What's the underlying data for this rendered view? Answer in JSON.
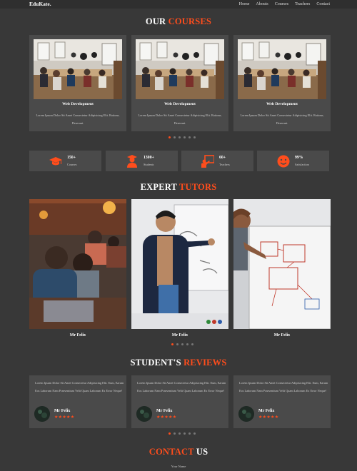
{
  "nav": {
    "logo": "EduKate.",
    "items": [
      "Home",
      "Abouts",
      "Courses",
      "Teachers",
      "Contact"
    ]
  },
  "courses": {
    "title_main": "OUR",
    "title_accent": "COURSES",
    "cards": [
      {
        "title": "Web Development",
        "desc": "Lorem Ipsum Dolor Sit Amet Consectetur Adipisicing Elit. Ratione, Deserunt."
      },
      {
        "title": "Web Development",
        "desc": "Lorem Ipsum Dolor Sit Amet Consectetur Adipisicing Elit. Ratione, Deserunt."
      },
      {
        "title": "Web Development",
        "desc": "Lorem Ipsum Dolor Sit Amet Consectetur Adipisicing Elit. Ratione, Deserunt."
      }
    ],
    "active_dot": 0,
    "dot_count": 6
  },
  "stats": [
    {
      "icon": "graduation-cap-icon",
      "value": "150+",
      "label": "Courses"
    },
    {
      "icon": "student-icon",
      "value": "1300+",
      "label": "Students"
    },
    {
      "icon": "teacher-board-icon",
      "value": "60+",
      "label": "Teachers"
    },
    {
      "icon": "smiley-icon",
      "value": "99%",
      "label": "Satisfaction"
    }
  ],
  "tutors": {
    "title_main": "EXPERT",
    "title_accent": "TUTORS",
    "items": [
      {
        "name": "Mr Felix"
      },
      {
        "name": "Mr Felix"
      },
      {
        "name": "Mr Felix"
      }
    ],
    "active_dot": 0,
    "dot_count": 5
  },
  "reviews": {
    "title_main": "STUDENT'S",
    "title_accent": "REVIEWS",
    "items": [
      {
        "text": "Lorem Ipsum Dolor Sit Amet Consectetur Adipisicing Elit. Eum, Earum Eos Laborum Nam Praesentium Velit Quam Laborum Ex Error Neque!",
        "name": "Mr Felix",
        "stars": "★★★★★"
      },
      {
        "text": "Lorem Ipsum Dolor Sit Amet Consectetur Adipisicing Elit. Eum, Earum Eos Laborum Nam Praesentium Velit Quam Laborum Ex Error Neque!",
        "name": "Mr Felix",
        "stars": "★★★★★"
      },
      {
        "text": "Lorem Ipsum Dolor Sit Amet Consectetur Adipisicing Elit. Eum, Earum Eos Laborum Nam Praesentium Velit Quam Laborum Ex Error Neque!",
        "name": "Mr Felix",
        "stars": "★★★★★"
      }
    ],
    "active_dot": 0,
    "dot_count": 6
  },
  "contact": {
    "title_accent": "CONTACT",
    "title_main": "US",
    "name_label": "Your Name"
  },
  "colors": {
    "accent": "#ff4d1c",
    "background": "#383838",
    "card": "#4a4a4a"
  }
}
